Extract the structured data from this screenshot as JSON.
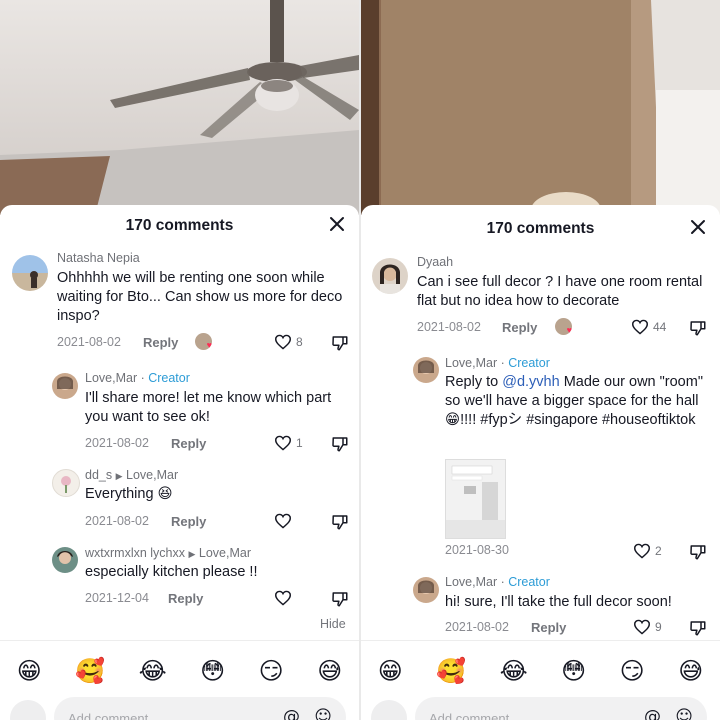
{
  "left": {
    "header": {
      "title": "170 comments"
    },
    "comments": [
      {
        "name": "Natasha Nepia",
        "text": "Ohhhhh we will be renting one soon while waiting for Bto... Can show us more for deco inspo?",
        "date": "2021-08-02",
        "reply": "Reply",
        "likes": "8"
      },
      {
        "name": "Love,Mar",
        "creator": "Creator",
        "sep": " · ",
        "text": "I'll share more! let me know which part you want to see ok!",
        "date": "2021-08-02",
        "reply": "Reply",
        "likes": "1"
      },
      {
        "name": "dd_s",
        "replyto": "Love,Mar",
        "text": "Everything",
        "emoji": "😆",
        "date": "2021-08-02",
        "reply": "Reply",
        "likes": ""
      },
      {
        "name": "wxtxrmxlxn lychxx",
        "replyto": "Love,Mar",
        "text": "especially kitchen please !!",
        "date": "2021-12-04",
        "reply": "Reply",
        "likes": ""
      }
    ],
    "hide_label": "Hide",
    "emojis": [
      "😁",
      "🥰",
      "😂",
      "😳",
      "😏",
      "😅"
    ],
    "composer": {
      "placeholder": "Add comment...",
      "at": "@",
      "smile": "☺"
    }
  },
  "right": {
    "header": {
      "title": "170 comments"
    },
    "comments": [
      {
        "name": "Dyaah",
        "text": "Can i see full decor ? I have one room rental flat but no idea how to decorate",
        "date": "2021-08-02",
        "reply": "Reply",
        "likes": "44"
      },
      {
        "name": "Love,Mar",
        "creator": "Creator",
        "sep": " · ",
        "text_pre": "Reply to ",
        "mention": "@d.yvhh",
        "text_post": "  Made our own \"room\" so we'll have a bigger space for the hall 😁!!!!  #fypシ #singapore #houseoftiktok",
        "date": "2021-08-30",
        "reply": "",
        "likes": "2"
      },
      {
        "name": "Love,Mar",
        "creator": "Creator",
        "sep": " · ",
        "text": "hi! sure, I'll take the full decor soon!",
        "date": "2021-08-02",
        "reply": "Reply",
        "likes": "9"
      }
    ],
    "emojis": [
      "😁",
      "🥰",
      "😂",
      "😳",
      "😏",
      "😅"
    ],
    "composer": {
      "placeholder": "Add comment...",
      "at": "@",
      "smile": "☺"
    }
  },
  "colors": {
    "creator": "#2d9cd6",
    "mention": "#2d5fb8",
    "text": "#161823",
    "muted": "#73757b"
  }
}
